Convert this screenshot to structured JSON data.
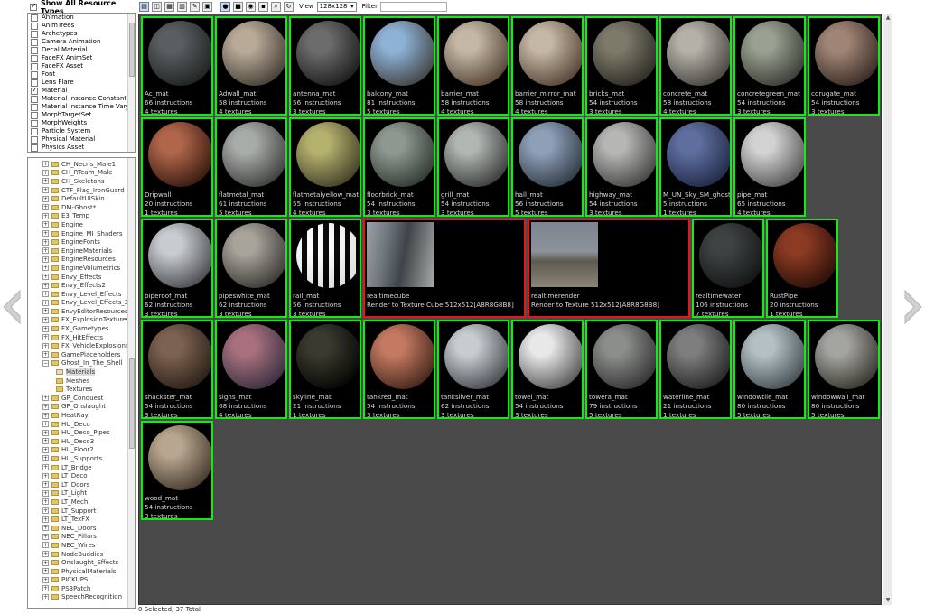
{
  "left_panel": {
    "show_all_label": "Show All Resource Types",
    "resource_types": [
      {
        "label": "Animation",
        "checked": false
      },
      {
        "label": "AnimTrees",
        "checked": false
      },
      {
        "label": "Archetypes",
        "checked": false
      },
      {
        "label": "Camera Animation",
        "checked": false
      },
      {
        "label": "Decal Material",
        "checked": false
      },
      {
        "label": "FaceFX AnimSet",
        "checked": false
      },
      {
        "label": "FaceFX Asset",
        "checked": false
      },
      {
        "label": "Font",
        "checked": false
      },
      {
        "label": "Lens Flare",
        "checked": false
      },
      {
        "label": "Material",
        "checked": true
      },
      {
        "label": "Material Instance Constant",
        "checked": false
      },
      {
        "label": "Material Instance Time Varying",
        "checked": false
      },
      {
        "label": "MorphTargetSet",
        "checked": false
      },
      {
        "label": "MorphWeights",
        "checked": false
      },
      {
        "label": "Particle System",
        "checked": false
      },
      {
        "label": "Physical Material",
        "checked": false
      },
      {
        "label": "Physics Asset",
        "checked": false
      }
    ],
    "packages": [
      {
        "label": "CH_Necris_Male1"
      },
      {
        "label": "CH_RTeam_Male"
      },
      {
        "label": "CH_Skeletons"
      },
      {
        "label": "CTF_Flag_IronGuard"
      },
      {
        "label": "DefaultUISkin"
      },
      {
        "label": "DM-Ghost*"
      },
      {
        "label": "E3_Temp"
      },
      {
        "label": "Engine"
      },
      {
        "label": "Engine_MI_Shaders"
      },
      {
        "label": "EngineFonts"
      },
      {
        "label": "EngineMaterials"
      },
      {
        "label": "EngineResources"
      },
      {
        "label": "EngineVolumetrics"
      },
      {
        "label": "Envy_Effects"
      },
      {
        "label": "Envy_Effects2"
      },
      {
        "label": "Envy_Level_Effects"
      },
      {
        "label": "Envy_Level_Effects_2"
      },
      {
        "label": "EnvyEditorResources"
      },
      {
        "label": "FX_ExplosionTextures"
      },
      {
        "label": "FX_Gametypes"
      },
      {
        "label": "FX_HitEffects"
      },
      {
        "label": "FX_VehicleExplosions"
      },
      {
        "label": "GamePlaceholders"
      },
      {
        "label": "Ghost_In_The_Shell"
      },
      {
        "label": "Materials",
        "child": true
      },
      {
        "label": "Meshes",
        "child": true
      },
      {
        "label": "Textures",
        "child": true
      },
      {
        "label": "GP_Conquest"
      },
      {
        "label": "GP_Onslaught"
      },
      {
        "label": "HeatRay"
      },
      {
        "label": "HU_Deco"
      },
      {
        "label": "HU_Deco_Pipes"
      },
      {
        "label": "HU_Deco3"
      },
      {
        "label": "HU_Floor2"
      },
      {
        "label": "HU_Supports"
      },
      {
        "label": "LT_Bridge"
      },
      {
        "label": "LT_Deco"
      },
      {
        "label": "LT_Doors"
      },
      {
        "label": "LT_Light"
      },
      {
        "label": "LT_Mech"
      },
      {
        "label": "LT_Support"
      },
      {
        "label": "LT_TexFX"
      },
      {
        "label": "NEC_Doors"
      },
      {
        "label": "NEC_Pillars"
      },
      {
        "label": "NEC_Wires"
      },
      {
        "label": "NodeBuddies"
      },
      {
        "label": "Onslaught_Effects"
      },
      {
        "label": "PhysicalMaterials"
      },
      {
        "label": "PICKUPS"
      },
      {
        "label": "PS3Patch"
      },
      {
        "label": "SpeechRecognition"
      }
    ]
  },
  "toolbar": {
    "view_label": "View",
    "view_value": "128x128",
    "filter_label": "Filter",
    "filter_value": ""
  },
  "status": "0 Selected, 37 Total",
  "rows": [
    [
      {
        "name": "Ac_mat",
        "lines": [
          "Ac_mat",
          "66 instructions",
          "4 textures"
        ],
        "colors": [
          "#5a5e60",
          "#1a1c1d"
        ]
      },
      {
        "name": "Adwall_mat",
        "lines": [
          "Adwall_mat",
          "58 instructions",
          "4 textures"
        ],
        "colors": [
          "#b9aa98",
          "#3a342c"
        ]
      },
      {
        "name": "antenna_mat",
        "lines": [
          "antenna_mat",
          "56 instructions",
          "3 textures"
        ],
        "colors": [
          "#6c6c6c",
          "#151515"
        ]
      },
      {
        "name": "balcony_mat",
        "lines": [
          "balcony_mat",
          "81 instructions",
          "5 textures"
        ],
        "colors": [
          "#8eb1d6",
          "#3a3a36"
        ]
      },
      {
        "name": "barrier_mat",
        "lines": [
          "barrier_mat",
          "58 instructions",
          "4 textures"
        ],
        "colors": [
          "#c4b7a5",
          "#4a3a2c"
        ]
      },
      {
        "name": "barrier_mirror_mat",
        "lines": [
          "barrier_mirror_mat",
          "58 instructions",
          "4 textures"
        ],
        "colors": [
          "#c4b7a5",
          "#4a3a2c"
        ]
      },
      {
        "name": "bricks_mat",
        "lines": [
          "bricks_mat",
          "54 instructions",
          "3 textures"
        ],
        "colors": [
          "#7e7a6a",
          "#26241f"
        ]
      },
      {
        "name": "concrete_mat",
        "lines": [
          "concrete_mat",
          "58 instructions",
          "4 textures"
        ],
        "colors": [
          "#b5b1a8",
          "#3d3b38"
        ]
      },
      {
        "name": "concretegreen_mat",
        "lines": [
          "concretegreen_mat",
          "54 instructions",
          "3 textures"
        ],
        "colors": [
          "#9aa092",
          "#2f332c"
        ]
      },
      {
        "name": "corugate_mat",
        "lines": [
          "corugate_mat",
          "54 instructions",
          "3 textures"
        ],
        "colors": [
          "#a08576",
          "#2e221c"
        ]
      }
    ],
    [
      {
        "name": "Dripwall",
        "lines": [
          "Dripwall",
          "20 instructions",
          "1 textures"
        ],
        "colors": [
          "#b0664a",
          "#2b120b"
        ]
      },
      {
        "name": "flatmetal_mat",
        "lines": [
          "flatmetal_mat",
          "61 instructions",
          "5 textures"
        ],
        "colors": [
          "#a8aca8",
          "#333533"
        ]
      },
      {
        "name": "flatmetalyellow_mat",
        "lines": [
          "flatmetalyellow_mat",
          "55 instructions",
          "4 textures"
        ],
        "colors": [
          "#b4b06e",
          "#383620"
        ]
      },
      {
        "name": "floorbrick_mat",
        "lines": [
          "floorbrick_mat",
          "54 instructions",
          "3 textures"
        ],
        "colors": [
          "#8e9890",
          "#283029"
        ]
      },
      {
        "name": "grill_mat",
        "lines": [
          "grill_mat",
          "54 instructions",
          "3 textures"
        ],
        "colors": [
          "#b0b6b2",
          "#2e302f"
        ]
      },
      {
        "name": "hall_mat",
        "lines": [
          "hall_mat",
          "56 instructions",
          "5 textures"
        ],
        "colors": [
          "#8ea0b8",
          "#28303a"
        ]
      },
      {
        "name": "highway_mat",
        "lines": [
          "highway_mat",
          "54 instructions",
          "3 textures"
        ],
        "colors": [
          "#b6b6b4",
          "#3a3a39"
        ]
      },
      {
        "name": "M_UN_Sky_SM_ghostblue",
        "lines": [
          "M_UN_Sky_SM_ghostblue",
          "5 instructions",
          "1 textures"
        ],
        "colors": [
          "#5e6e9e",
          "#1c2340"
        ]
      },
      {
        "name": "pipe_mat",
        "lines": [
          "pipe_mat",
          "65 instructions",
          "4 textures"
        ],
        "colors": [
          "#d2d2d2",
          "#4a4a4a"
        ]
      }
    ],
    [
      {
        "name": "piperoof_mat",
        "lines": [
          "piperoof_mat",
          "62 instructions",
          "3 textures"
        ],
        "colors": [
          "#c8cbd0",
          "#3c3e42"
        ]
      },
      {
        "name": "pipeswhite_mat",
        "lines": [
          "pipeswhite_mat",
          "62 instructions",
          "3 textures"
        ],
        "colors": [
          "#a8a49c",
          "#302e2a"
        ]
      },
      {
        "name": "rail_mat",
        "lines": [
          "rail_mat",
          "56 instructions",
          "3 textures"
        ],
        "colors": [
          "#e6e6e6",
          "#0a0a0a"
        ],
        "striped": true
      },
      {
        "name": "realtimecube",
        "lines": [
          "realtimecube",
          "Render to Texture Cube 512x512[A8R8G8B8]"
        ],
        "render": true
      },
      {
        "name": "realtimerender",
        "lines": [
          "realtimerender",
          "Render to Texture 512x512[A8R8G8B8]"
        ],
        "render": true
      },
      {
        "name": "realtimewater",
        "lines": [
          "realtimewater",
          "106 instructions",
          "7 textures",
          "M.T.D.L.: 2"
        ],
        "colors": [
          "#3e4242",
          "#101212"
        ]
      },
      {
        "name": "RustPipe",
        "lines": [
          "RustPipe",
          "20 instructions",
          "1 textures"
        ],
        "colors": [
          "#8c3a24",
          "#220c06"
        ]
      }
    ],
    [
      {
        "name": "shackster_mat",
        "lines": [
          "shackster_mat",
          "54 instructions",
          "3 textures"
        ],
        "colors": [
          "#7c6250",
          "#231a14"
        ]
      },
      {
        "name": "signs_mat",
        "lines": [
          "signs_mat",
          "68 instructions",
          "4 textures"
        ],
        "colors": [
          "#a8707e",
          "#2e2a3a"
        ]
      },
      {
        "name": "skyline_mat",
        "lines": [
          "skyline_mat",
          "21 instructions",
          "1 textures"
        ],
        "colors": [
          "#3a3a30",
          "#000000"
        ]
      },
      {
        "name": "tankred_mat",
        "lines": [
          "tankred_mat",
          "54 instructions",
          "3 textures"
        ],
        "colors": [
          "#c47a62",
          "#3a1e14"
        ]
      },
      {
        "name": "tanksilver_mat",
        "lines": [
          "tanksilver_mat",
          "62 instructions",
          "3 textures"
        ],
        "colors": [
          "#c6ccd0",
          "#3a3e42"
        ]
      },
      {
        "name": "towel_mat",
        "lines": [
          "towel_mat",
          "54 instructions",
          "3 textures"
        ],
        "colors": [
          "#e8e8e8",
          "#4a4a4a"
        ]
      },
      {
        "name": "towera_mat",
        "lines": [
          "towera_mat",
          "79 instructions",
          "5 textures"
        ],
        "colors": [
          "#8c8e8c",
          "#2a2b2a"
        ]
      },
      {
        "name": "waterline_mat",
        "lines": [
          "waterline_mat",
          "21 instructions",
          "1 textures"
        ],
        "colors": [
          "#7e7e7e",
          "#1e1e1e"
        ]
      },
      {
        "name": "windowtile_mat",
        "lines": [
          "windowtile_mat",
          "80 instructions",
          "5 textures"
        ],
        "colors": [
          "#b4c0c4",
          "#3a4448"
        ]
      },
      {
        "name": "windowwall_mat",
        "lines": [
          "windowwall_mat",
          "80 instructions",
          "5 textures"
        ],
        "colors": [
          "#a4a4a0",
          "#2e2a24"
        ]
      }
    ],
    [
      {
        "name": "wood_mat",
        "lines": [
          "wood_mat",
          "54 instructions",
          "3 textures"
        ],
        "colors": [
          "#b8a690",
          "#3a3024"
        ]
      }
    ]
  ]
}
